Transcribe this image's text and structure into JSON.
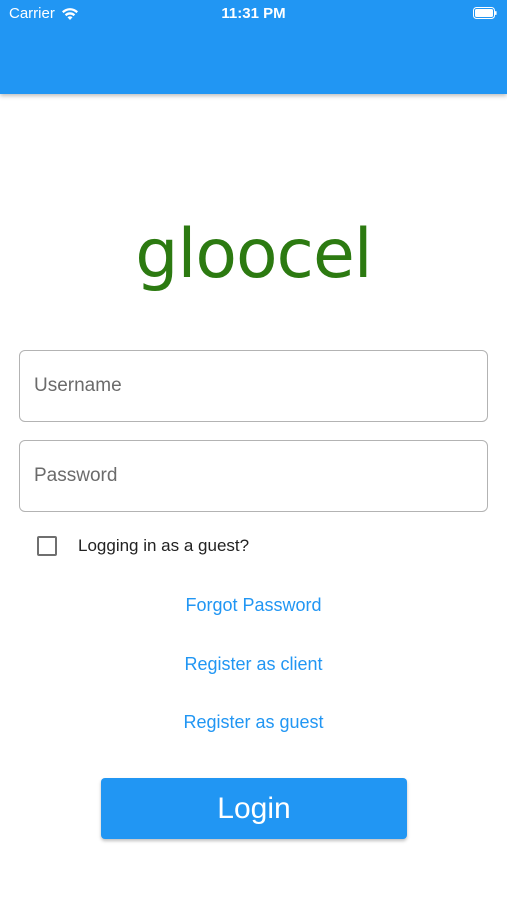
{
  "status_bar": {
    "carrier": "Carrier",
    "time": "11:31 PM",
    "icons": [
      "wifi-icon",
      "battery-icon"
    ]
  },
  "app": {
    "logo_text": "gloocel",
    "colors": {
      "primary": "#2196f3",
      "logo": "#2c7a11"
    }
  },
  "form": {
    "username_placeholder": "Username",
    "username_value": "",
    "password_placeholder": "Password",
    "password_value": "",
    "guest_checkbox_label": "Logging in as a guest?",
    "guest_checked": false
  },
  "links": {
    "forgot_password": "Forgot Password",
    "register_client": "Register as client",
    "register_guest": "Register as guest"
  },
  "login_button": "Login"
}
